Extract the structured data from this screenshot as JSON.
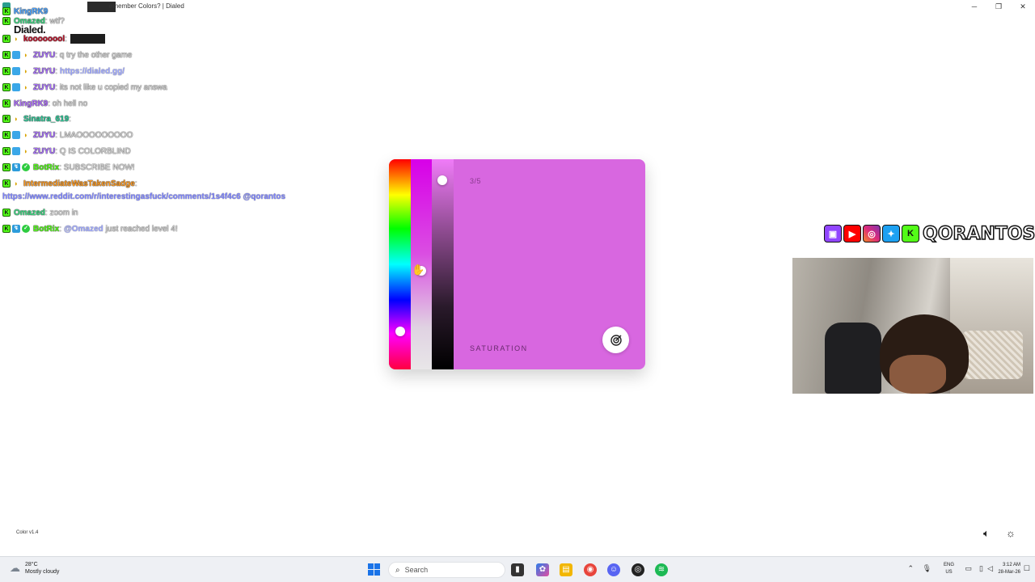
{
  "window": {
    "title": "emember Colors? | Dialed",
    "minimize": "─",
    "restore": "❐",
    "close": "✕"
  },
  "site": {
    "logo": "Dialed."
  },
  "chat": {
    "lines": [
      {
        "user": "Omazed",
        "color": "#3ddc84",
        "message": ": wtf?",
        "mention": ""
      },
      {
        "user": "koooooool",
        "color": "#c0142b",
        "message": ":",
        "mention": ""
      },
      {
        "user": "ZUYU",
        "color": "#a970ff",
        "message": ": q try the other game",
        "mention": ""
      },
      {
        "user": "ZUYU",
        "color": "#a970ff",
        "message": ":",
        "mention": "https://dialed.gg/"
      },
      {
        "user": "ZUYU",
        "color": "#a970ff",
        "message": ": its not like u copied my answa",
        "mention": ""
      },
      {
        "user": "KingRK9",
        "color": "#b070ff",
        "message": ": oh hell no",
        "mention": ""
      },
      {
        "user": "Sinatra_619",
        "color": "#2ecc9a",
        "message": ":",
        "mention": ""
      },
      {
        "user": "ZUYU",
        "color": "#a970ff",
        "message": ": LMAOOOOOOOOO",
        "mention": ""
      },
      {
        "user": "ZUYU",
        "color": "#a970ff",
        "message": ": Q IS COLORBLIND",
        "mention": ""
      },
      {
        "user": "BotRix",
        "color": "#53fc18",
        "message": ": SUBSCRIBE NOW!",
        "mention": ""
      },
      {
        "user": "IntermediateWasTakenSadge",
        "color": "#ff9a1f",
        "message": ":",
        "mention": ""
      },
      {
        "user": "Omazed",
        "color": "#3ddc84",
        "message": ": zoom in",
        "mention": ""
      },
      {
        "user": "BotRix",
        "color": "#53fc18",
        "message": ":",
        "mention": "@Omazed",
        "tail": "just reached level 4!"
      }
    ],
    "wrapped_link": "https://www.reddit.com/r/interestingasfuck/comments/1s4f4c6 @qorantos",
    "title_overlap_user": "KingRK9"
  },
  "game": {
    "progress": "3/5",
    "mode_label": "SATURATION",
    "hue_knob_fraction": 0.82,
    "saturation_knob_fraction": 0.53,
    "lightness_knob_fraction": 0.1,
    "target_color": "#d867e0",
    "submit_icon": "target-icon"
  },
  "stream": {
    "social_icons": [
      "twitch",
      "youtube",
      "instagram",
      "twitter",
      "kick"
    ],
    "channel_name": "QORANTOS"
  },
  "footer": {
    "version": "Color v1.4"
  },
  "taskbar": {
    "weather_temp": "28°C",
    "weather_desc": "Mostly cloudy",
    "search_placeholder": "Search",
    "lang_top": "ENG",
    "lang_bottom": "US",
    "time": "3:12 AM",
    "date": "28-Mar-26"
  }
}
